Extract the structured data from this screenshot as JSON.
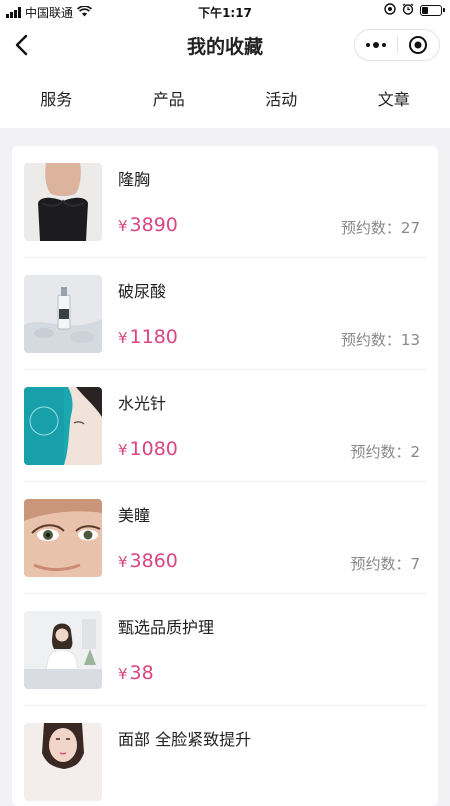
{
  "status_bar": {
    "carrier": "中国联通",
    "time": "下午1:17"
  },
  "nav": {
    "title": "我的收藏",
    "back_icon": "chevron-left-icon",
    "more_icon": "more-dots-icon",
    "close_icon": "target-close-icon"
  },
  "tabs": [
    {
      "label": "服务"
    },
    {
      "label": "产品"
    },
    {
      "label": "活动"
    },
    {
      "label": "文章"
    }
  ],
  "currency": "¥",
  "bookings_label": "预约数：",
  "items": [
    {
      "name": "隆胸",
      "price": "3890",
      "bookings": "27"
    },
    {
      "name": "破尿酸",
      "price": "1180",
      "bookings": "13"
    },
    {
      "name": "水光针",
      "price": "1080",
      "bookings": "2"
    },
    {
      "name": "美瞳",
      "price": "3860",
      "bookings": "7"
    },
    {
      "name": "甄选品质护理",
      "price": "38",
      "bookings": ""
    },
    {
      "name": "面部 全脸紧致提升",
      "price": "",
      "bookings": ""
    }
  ],
  "colors": {
    "price": "#d9467c",
    "background": "#f2f2f4"
  }
}
